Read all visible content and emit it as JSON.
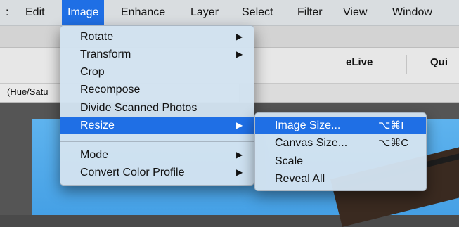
{
  "menubar": {
    "items": [
      {
        "label": "Edit"
      },
      {
        "label": "Image"
      },
      {
        "label": "Enhance"
      },
      {
        "label": "Layer"
      },
      {
        "label": "Select"
      },
      {
        "label": "Filter"
      },
      {
        "label": "View"
      },
      {
        "label": "Window"
      }
    ],
    "active_index": 1,
    "accent_color": "#1f6fe5"
  },
  "toolbar": {
    "mode_tabs": [
      {
        "label": "eLive"
      },
      {
        "label": "Qui"
      }
    ]
  },
  "document": {
    "tab_label": "(Hue/Satu"
  },
  "image_menu": {
    "items": [
      {
        "label": "Rotate",
        "submenu": true
      },
      {
        "label": "Transform",
        "submenu": true
      },
      {
        "label": "Crop",
        "submenu": false
      },
      {
        "label": "Recompose",
        "submenu": false
      },
      {
        "label": "Divide Scanned Photos",
        "submenu": false
      },
      {
        "label": "Resize",
        "submenu": true,
        "highlighted": true
      },
      {
        "label": "Mode",
        "submenu": true
      },
      {
        "label": "Convert Color Profile",
        "submenu": true
      }
    ],
    "arrow_glyph": "▶"
  },
  "resize_submenu": {
    "items": [
      {
        "label": "Image Size...",
        "shortcut": "⌥⌘I",
        "highlighted": true
      },
      {
        "label": "Canvas Size...",
        "shortcut": "⌥⌘C"
      },
      {
        "label": "Scale",
        "shortcut": ""
      },
      {
        "label": "Reveal All",
        "shortcut": ""
      }
    ]
  }
}
